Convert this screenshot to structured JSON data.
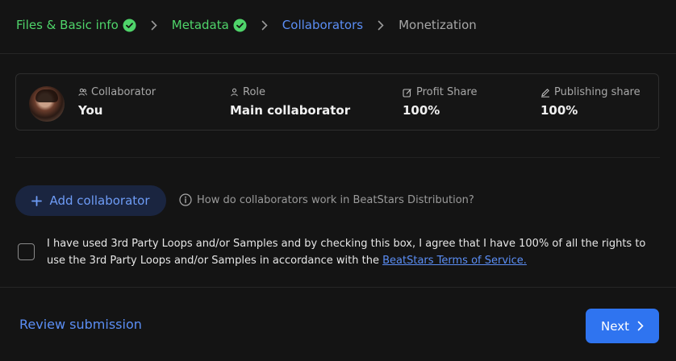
{
  "stepper": {
    "steps": [
      {
        "label": "Files & Basic info",
        "state": "done"
      },
      {
        "label": "Metadata",
        "state": "done"
      },
      {
        "label": "Collaborators",
        "state": "active"
      },
      {
        "label": "Monetization",
        "state": "pending"
      }
    ]
  },
  "collaborator_card": {
    "columns": [
      {
        "label": "Collaborator",
        "value": "You",
        "icon": "users-icon"
      },
      {
        "label": "Role",
        "value": "Main collaborator",
        "icon": "user-icon"
      },
      {
        "label": "Profit Share",
        "value": "100%",
        "icon": "edit-square-icon"
      },
      {
        "label": "Publishing share",
        "value": "100%",
        "icon": "pen-icon"
      }
    ]
  },
  "add_collaborator": {
    "label": "Add collaborator",
    "icon": "plus-icon"
  },
  "help": {
    "text": "How do collaborators work in BeatStars Distribution?",
    "icon": "info-icon"
  },
  "terms": {
    "text": "I have used 3rd Party Loops and/or Samples and by checking this box, I agree that I have 100% of all the rights to use the 3rd Party Loops and/or Samples in accordance with the ",
    "link": "BeatStars Terms of Service.",
    "checked": false
  },
  "footer": {
    "review_label": "Review submission",
    "next_label": "Next"
  },
  "colors": {
    "background": "#141414",
    "accent_blue": "#5b8ef5",
    "success_green": "#4fd46a",
    "primary_button": "#2f74f0"
  }
}
